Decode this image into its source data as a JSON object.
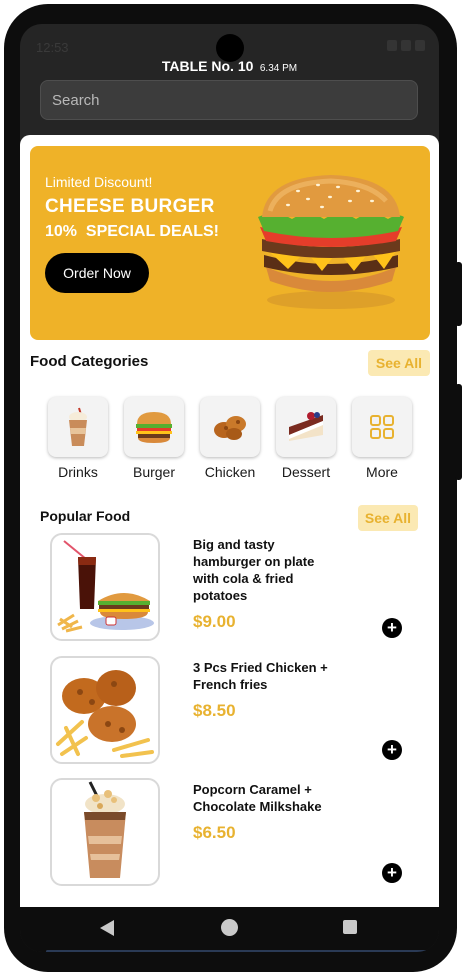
{
  "status": {
    "time": "12:53"
  },
  "header": {
    "table_label": "TABLE No. 10",
    "time": "6.34 PM"
  },
  "search": {
    "placeholder": "Search"
  },
  "banner": {
    "subtitle": "Limited Discount!",
    "title": "CHEESE BURGER",
    "deal": "10%  SPECIAL DEALS!",
    "button_label": "Order Now",
    "bg_color": "#efb228"
  },
  "categories": {
    "title": "Food Categories",
    "see_all": "See All",
    "items": [
      {
        "label": "Drinks",
        "icon": "milkshake-icon"
      },
      {
        "label": "Burger",
        "icon": "burger-icon"
      },
      {
        "label": "Chicken",
        "icon": "fried-chicken-icon"
      },
      {
        "label": "Dessert",
        "icon": "cake-icon"
      },
      {
        "label": "More",
        "icon": "grid-icon"
      }
    ]
  },
  "popular": {
    "title": "Popular Food",
    "see_all": "See All",
    "items": [
      {
        "name": "Big and tasty hamburger on plate with cola & fried potatoes",
        "price": "$9.00",
        "image": "burger-cola-fries-image"
      },
      {
        "name": "3 Pcs Fried Chicken + French fries",
        "price": "$8.50",
        "image": "fried-chicken-fries-image"
      },
      {
        "name": "Popcorn Caramel + Chocolate Milkshake",
        "price": "$6.50",
        "image": "milkshake-image"
      }
    ]
  },
  "colors": {
    "accent": "#e8b230",
    "accent_light": "#fbe9b3",
    "dark": "#0d0d0d"
  }
}
